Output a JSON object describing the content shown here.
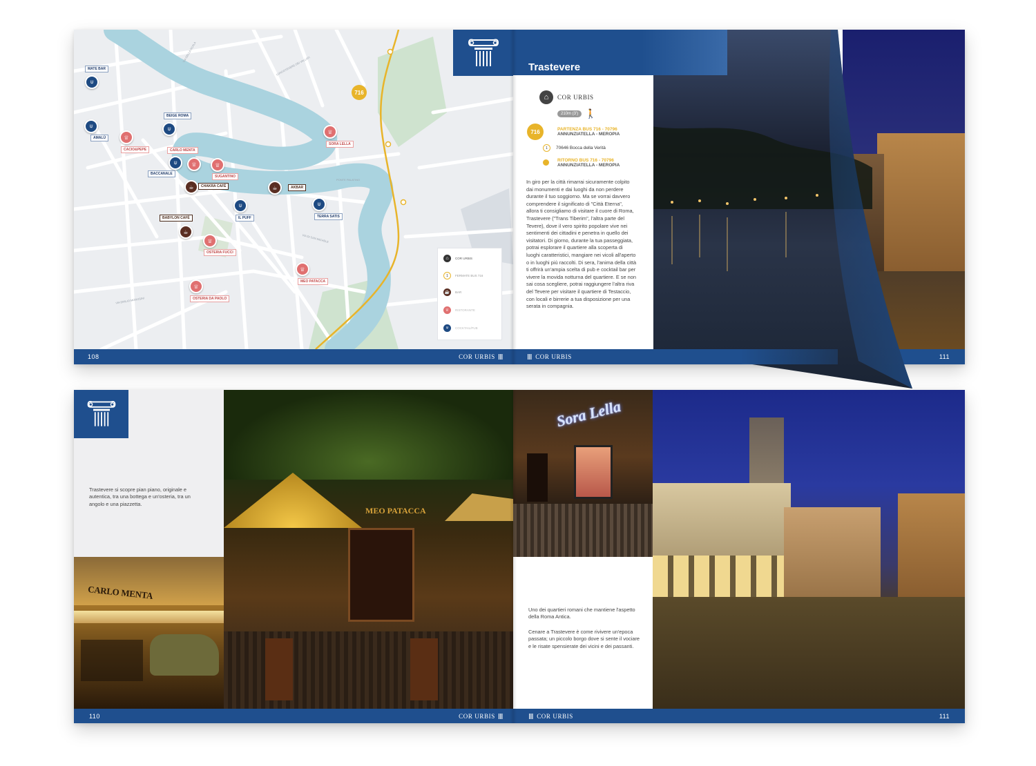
{
  "spread1": {
    "left_page_number": "108",
    "right_page_number": "111",
    "footer_brand": "COR URBIS",
    "section_title": "Trastevere",
    "start_point": "COR URBIS",
    "walk_time": "210m (3')",
    "bus_badge": "716",
    "departure_line1": "PARTENZA BUS 716 - 70796",
    "departure_line2": "ANNUNZIATELLA - MEROPIA",
    "stop_number": "1",
    "stop_name": "70646 Bocca della Verità",
    "return_line1": "RITORNO BUS 716 - 70796",
    "return_line2": "ANNUNZIATELLA - MEROPIA",
    "body_text": "In giro per la città rimarrai sicuramente colpito dai monumenti e dai luoghi da non perdere durante il tuo soggiorno. Ma se vorrai davvero comprendere il significato di \"Città Eterna\", allora ti consigliamo di visitare il cuore di Roma, Trastevere (\"Trans Tiberim\", l'altra parte del Tevere), dove il vero spirito popolare vive nei sentimenti dei cittadini e penetra in quello dei visitatori. Di giorno, durante la tua passeggiata, potrai esplorare il quartiere alla scoperta di luoghi caratteristici, mangiare nei vicoli all'aperto o in luoghi più raccolti. Di sera, l'anima della città ti offrirà un'ampia scelta di pub e cocktail bar per vivere la movida notturna del quartiere. E se non sai cosa scegliere, potrai raggiungere l'altra riva del Tevere per visitare il quartiere di Testaccio, con locali e birrerie a tua disposizione per una serata in compagnia.",
    "map": {
      "bus_badge": "716",
      "labels": [
        {
          "text": "MATE BAR",
          "type": "bar"
        },
        {
          "text": "AMALÙ",
          "type": "bar"
        },
        {
          "text": "BEIGE ROMA",
          "type": "bar"
        },
        {
          "text": "CACIO&PEPE",
          "type": "rist"
        },
        {
          "text": "CARLO MENTA",
          "type": "rist"
        },
        {
          "text": "BACCANALE",
          "type": "bar"
        },
        {
          "text": "SUGANTINO",
          "type": "rist"
        },
        {
          "text": "CHAKRA CAFÈ",
          "type": "cafe"
        },
        {
          "text": "AKBAR",
          "type": "cafe"
        },
        {
          "text": "SORA LELLA",
          "type": "rist"
        },
        {
          "text": "BABYLON CAFÈ",
          "type": "cafe"
        },
        {
          "text": "IL PUFF",
          "type": "bar"
        },
        {
          "text": "TERRA SATIS",
          "type": "bar"
        },
        {
          "text": "OSTERIA FUCCI",
          "type": "rist"
        },
        {
          "text": "MEO PATACCA",
          "type": "rist"
        },
        {
          "text": "OSTERIA DA PAOLO",
          "type": "rist"
        }
      ],
      "legend": [
        {
          "text": "COR URBIS",
          "icon": "house-icon"
        },
        {
          "text": "FERMATE BUS 716",
          "icon": "bus-stop-icon"
        },
        {
          "text": "BAR",
          "icon": "cup-icon"
        },
        {
          "text": "RISTORANTE",
          "icon": "chef-hat-icon"
        },
        {
          "text": "COCKTAIL/PUB",
          "icon": "cocktail-icon"
        }
      ]
    }
  },
  "spread2": {
    "left_page_number": "110",
    "right_page_number": "111",
    "footer_brand": "COR URBIS",
    "left_caption": "Trastevere si scopre pian piano, originale e autentica, tra una bottega e un'osteria, tra un angolo e una piazzetta.",
    "right_caption_1": "Uno dei quartieri romani che mantiene l'aspetto della Roma Antica.",
    "right_caption_2": "Cenare a Trastevere è come rivivere un'epoca passata; un piccolo borgo dove si sente il vociare e le risate spensierate dei vicini e dei passanti.",
    "sign_carlo_menta": "CARLO MENTA",
    "sign_sora_lella": "Sora Lella",
    "sign_meo_patacca": "MEO PATACCA"
  },
  "colors": {
    "brand_blue": "#1f4f8e",
    "accent_yellow": "#e8b42a",
    "river": "#aad3df"
  }
}
